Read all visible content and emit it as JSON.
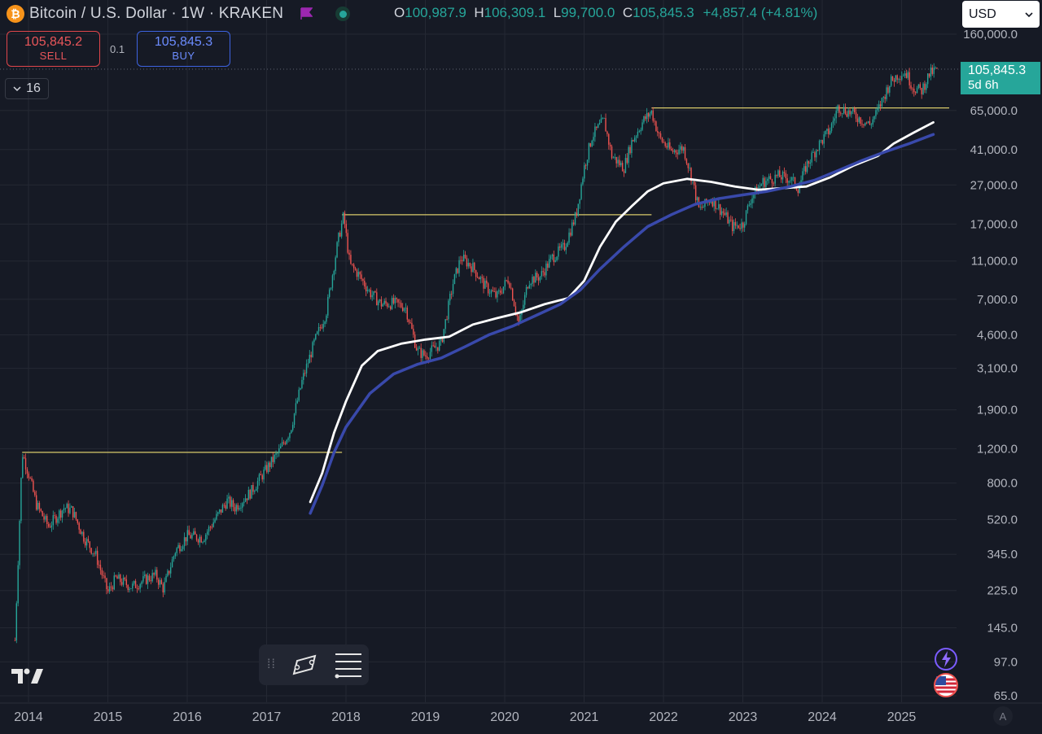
{
  "header": {
    "title": "Bitcoin / U.S. Dollar · 1W · KRAKEN",
    "coin_glyph": "₿",
    "ohlc": {
      "o_label": "O",
      "o": "100,987.9",
      "h_label": "H",
      "h": "106,309.1",
      "l_label": "L",
      "l": "99,700.0",
      "c_label": "C",
      "c": "105,845.3",
      "change": "+4,857.4 (+4.81%)"
    }
  },
  "trade": {
    "sell_price": "105,845.2",
    "sell_label": "SELL",
    "quantity": "0.1",
    "buy_price": "105,845.3",
    "buy_label": "BUY"
  },
  "indicators_collapse": {
    "count": "16"
  },
  "currency_select": {
    "value": "USD"
  },
  "price_tag": {
    "price": "105,845.3",
    "countdown": "5d 6h"
  },
  "icons": {
    "coin": "bitcoin-icon",
    "flag": "flag-icon",
    "live": "market-open-icon",
    "collapse": "chevron-down-icon",
    "select": "chevron-down-icon",
    "drag": "drag-handle-icon",
    "drawing": "drawing-tools-icon",
    "menu": "menu-lines-icon",
    "logo": "tradingview-logo",
    "ai": "lightning-icon",
    "region": "us-flag-icon",
    "auto": "auto-scale-icon"
  },
  "auto_label": "A",
  "colors": {
    "background": "#161a25",
    "up": "#26a69a",
    "down": "#ef5350",
    "ma_white": "#ffffff",
    "ma_blue": "#3949ab",
    "hline": "#d8c96a",
    "grid": "#242833"
  },
  "chart_data": {
    "type": "candlestick",
    "scale": "log",
    "grid": true,
    "x_axis_ticks": [
      "2014",
      "2015",
      "2016",
      "2017",
      "2018",
      "2019",
      "2020",
      "2021",
      "2022",
      "2023",
      "2024",
      "2025"
    ],
    "y_axis_ticks": [
      "160,000.0",
      "65,000.0",
      "41,000.0",
      "27,000.0",
      "17,000.0",
      "11,000.0",
      "7,000.0",
      "4,600.0",
      "3,100.0",
      "1,900.0",
      "1,200.0",
      "800.0",
      "520.0",
      "345.0",
      "225.0",
      "145.0",
      "97.0",
      "65.0"
    ],
    "ylim": [
      65,
      160000
    ],
    "xlim": [
      2013.8,
      2025.6
    ],
    "last_price": 105845.3,
    "price_path": [
      [
        2013.83,
        125
      ],
      [
        2013.92,
        1150
      ],
      [
        2014.0,
        900
      ],
      [
        2014.1,
        620
      ],
      [
        2014.25,
        480
      ],
      [
        2014.45,
        600
      ],
      [
        2014.55,
        580
      ],
      [
        2014.7,
        420
      ],
      [
        2014.85,
        340
      ],
      [
        2015.0,
        220
      ],
      [
        2015.1,
        260
      ],
      [
        2015.3,
        235
      ],
      [
        2015.5,
        260
      ],
      [
        2015.6,
        270
      ],
      [
        2015.7,
        230
      ],
      [
        2015.85,
        360
      ],
      [
        2016.0,
        430
      ],
      [
        2016.2,
        420
      ],
      [
        2016.4,
        560
      ],
      [
        2016.5,
        650
      ],
      [
        2016.6,
        600
      ],
      [
        2016.8,
        720
      ],
      [
        2017.0,
        950
      ],
      [
        2017.15,
        1150
      ],
      [
        2017.3,
        1500
      ],
      [
        2017.45,
        2700
      ],
      [
        2017.6,
        4200
      ],
      [
        2017.75,
        6000
      ],
      [
        2017.9,
        14000
      ],
      [
        2017.97,
        18800
      ],
      [
        2018.05,
        10500
      ],
      [
        2018.15,
        9500
      ],
      [
        2018.3,
        7600
      ],
      [
        2018.45,
        6600
      ],
      [
        2018.6,
        6700
      ],
      [
        2018.75,
        6400
      ],
      [
        2018.9,
        3800
      ],
      [
        2019.0,
        3600
      ],
      [
        2019.2,
        4200
      ],
      [
        2019.35,
        8500
      ],
      [
        2019.45,
        11500
      ],
      [
        2019.6,
        10200
      ],
      [
        2019.75,
        8200
      ],
      [
        2019.9,
        7200
      ],
      [
        2020.05,
        9000
      ],
      [
        2020.18,
        5200
      ],
      [
        2020.3,
        8800
      ],
      [
        2020.45,
        9200
      ],
      [
        2020.6,
        11500
      ],
      [
        2020.75,
        13000
      ],
      [
        2020.9,
        19000
      ],
      [
        2021.0,
        33000
      ],
      [
        2021.1,
        48000
      ],
      [
        2021.25,
        58000
      ],
      [
        2021.35,
        38000
      ],
      [
        2021.5,
        33000
      ],
      [
        2021.6,
        45000
      ],
      [
        2021.75,
        58000
      ],
      [
        2021.85,
        64000
      ],
      [
        2021.95,
        47000
      ],
      [
        2022.1,
        40000
      ],
      [
        2022.25,
        42000
      ],
      [
        2022.35,
        30000
      ],
      [
        2022.45,
        20000
      ],
      [
        2022.6,
        23000
      ],
      [
        2022.75,
        19500
      ],
      [
        2022.87,
        16500
      ],
      [
        2023.0,
        17000
      ],
      [
        2023.1,
        23000
      ],
      [
        2023.25,
        28000
      ],
      [
        2023.45,
        30000
      ],
      [
        2023.6,
        29000
      ],
      [
        2023.7,
        26000
      ],
      [
        2023.8,
        34000
      ],
      [
        2023.95,
        43000
      ],
      [
        2024.1,
        52000
      ],
      [
        2024.2,
        68000
      ],
      [
        2024.4,
        62000
      ],
      [
        2024.5,
        58000
      ],
      [
        2024.6,
        55000
      ],
      [
        2024.7,
        65000
      ],
      [
        2024.85,
        90000
      ],
      [
        2024.95,
        99000
      ],
      [
        2025.05,
        102000
      ],
      [
        2025.15,
        85000
      ],
      [
        2025.25,
        82000
      ],
      [
        2025.35,
        100000
      ],
      [
        2025.45,
        105845
      ]
    ],
    "moving_averages": [
      {
        "color": "#ffffff",
        "points": [
          [
            2017.55,
            640
          ],
          [
            2017.7,
            900
          ],
          [
            2017.85,
            1450
          ],
          [
            2018.0,
            2100
          ],
          [
            2018.2,
            3200
          ],
          [
            2018.4,
            3800
          ],
          [
            2018.7,
            4150
          ],
          [
            2019.0,
            4350
          ],
          [
            2019.3,
            4500
          ],
          [
            2019.6,
            5200
          ],
          [
            2019.9,
            5600
          ],
          [
            2020.2,
            6000
          ],
          [
            2020.5,
            6600
          ],
          [
            2020.8,
            7100
          ],
          [
            2021.0,
            8700
          ],
          [
            2021.2,
            13000
          ],
          [
            2021.4,
            17500
          ],
          [
            2021.6,
            21000
          ],
          [
            2021.8,
            25000
          ],
          [
            2022.0,
            27500
          ],
          [
            2022.3,
            29000
          ],
          [
            2022.6,
            28000
          ],
          [
            2022.9,
            26500
          ],
          [
            2023.2,
            25500
          ],
          [
            2023.5,
            26000
          ],
          [
            2023.8,
            26500
          ],
          [
            2024.1,
            29500
          ],
          [
            2024.4,
            34000
          ],
          [
            2024.7,
            38000
          ],
          [
            2024.9,
            44000
          ],
          [
            2025.15,
            50000
          ],
          [
            2025.4,
            56500
          ]
        ]
      },
      {
        "color": "#3949ab",
        "points": [
          [
            2017.55,
            560
          ],
          [
            2017.7,
            780
          ],
          [
            2017.85,
            1150
          ],
          [
            2018.0,
            1550
          ],
          [
            2018.3,
            2300
          ],
          [
            2018.6,
            2900
          ],
          [
            2018.9,
            3250
          ],
          [
            2019.2,
            3500
          ],
          [
            2019.5,
            4000
          ],
          [
            2019.8,
            4600
          ],
          [
            2020.1,
            5100
          ],
          [
            2020.4,
            5800
          ],
          [
            2020.7,
            6600
          ],
          [
            2020.95,
            7800
          ],
          [
            2021.2,
            10000
          ],
          [
            2021.5,
            13000
          ],
          [
            2021.8,
            16500
          ],
          [
            2022.1,
            19000
          ],
          [
            2022.4,
            21500
          ],
          [
            2022.7,
            23000
          ],
          [
            2023.0,
            24000
          ],
          [
            2023.3,
            25000
          ],
          [
            2023.6,
            26500
          ],
          [
            2023.9,
            28500
          ],
          [
            2024.2,
            32000
          ],
          [
            2024.5,
            36000
          ],
          [
            2024.8,
            40000
          ],
          [
            2025.1,
            44000
          ],
          [
            2025.4,
            49000
          ]
        ]
      }
    ],
    "horizontal_lines": [
      {
        "price": 1150,
        "x_from": 2013.92,
        "x_to": 2017.95
      },
      {
        "price": 19000,
        "x_from": 2017.95,
        "x_to": 2021.85
      },
      {
        "price": 67000,
        "x_from": 2021.85,
        "x_to": 2025.6
      }
    ],
    "dotted_last_price_line": 105845.3
  }
}
